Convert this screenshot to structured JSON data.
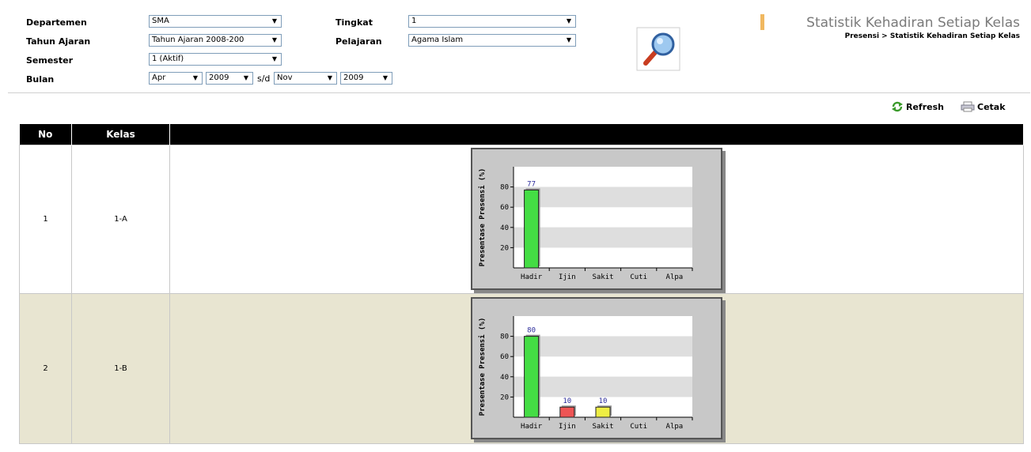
{
  "filters": {
    "departemen": {
      "label": "Departemen",
      "value": "SMA"
    },
    "tahun_ajaran": {
      "label": "Tahun Ajaran",
      "value": "Tahun Ajaran 2008-200"
    },
    "semester": {
      "label": "Semester",
      "value": "1 (Aktif)"
    },
    "bulan": {
      "label": "Bulan",
      "month_from": "Apr",
      "year_from": "2009",
      "sd": "s/d",
      "month_to": "Nov",
      "year_to": "2009"
    },
    "tingkat": {
      "label": "Tingkat",
      "value": "1"
    },
    "pelajaran": {
      "label": "Pelajaran",
      "value": "Agama Islam"
    }
  },
  "header": {
    "title": "Statistik Kehadiran Setiap Kelas",
    "breadcrumb": "Presensi  >  Statistik Kehadiran Setiap Kelas"
  },
  "toolbar": {
    "refresh": "Refresh",
    "cetak": "Cetak"
  },
  "table": {
    "columns": [
      "No",
      "Kelas",
      ""
    ],
    "rows": [
      {
        "no": "1",
        "kelas": "1-A"
      },
      {
        "no": "2",
        "kelas": "1-B"
      }
    ]
  },
  "chart_data": [
    {
      "type": "bar",
      "ylabel": "Presentase Presensi (%)",
      "categories": [
        "Hadir",
        "Ijin",
        "Sakit",
        "Cuti",
        "Alpa"
      ],
      "values": [
        77,
        0,
        0,
        0,
        0
      ],
      "data_labels": [
        "77",
        "",
        "",
        "",
        ""
      ],
      "yticks": [
        20,
        40,
        60,
        80
      ],
      "ylim": [
        0,
        100
      ],
      "colors": [
        "#44dd44",
        "#ee5555",
        "#eeee44",
        "#cccccc",
        "#cccccc"
      ]
    },
    {
      "type": "bar",
      "ylabel": "Presentase Presensi (%)",
      "categories": [
        "Hadir",
        "Ijin",
        "Sakit",
        "Cuti",
        "Alpa"
      ],
      "values": [
        80,
        10,
        10,
        0,
        0
      ],
      "data_labels": [
        "80",
        "10",
        "10",
        "",
        ""
      ],
      "yticks": [
        20,
        40,
        60,
        80
      ],
      "ylim": [
        0,
        100
      ],
      "colors": [
        "#44dd44",
        "#ee5555",
        "#eeee44",
        "#cccccc",
        "#cccccc"
      ]
    }
  ]
}
